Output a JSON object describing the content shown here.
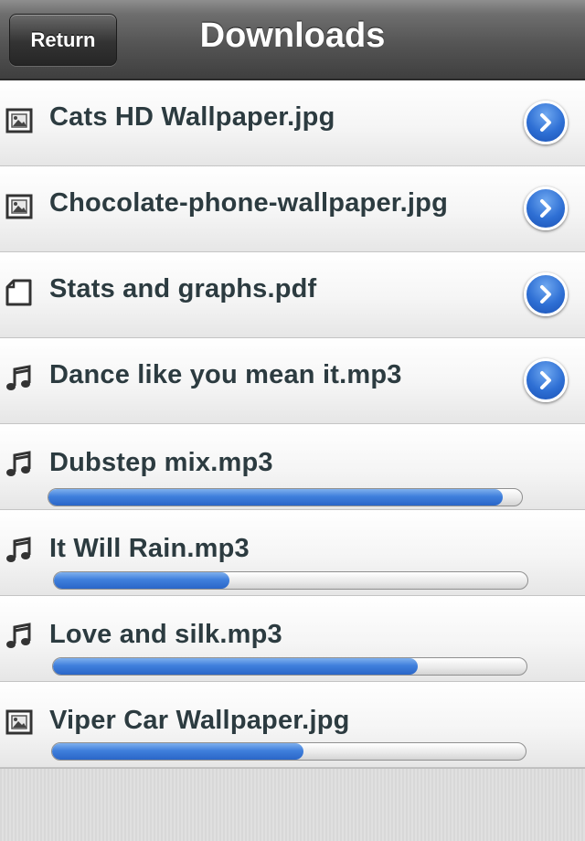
{
  "navbar": {
    "title": "Downloads",
    "return_label": "Return"
  },
  "items": [
    {
      "name": "Cats HD Wallpaper.jpg",
      "type": "image",
      "status": "complete"
    },
    {
      "name": "Chocolate-phone-wallpaper.jpg",
      "type": "image",
      "status": "complete"
    },
    {
      "name": "Stats and graphs.pdf",
      "type": "document",
      "status": "complete"
    },
    {
      "name": "Dance like you mean it.mp3",
      "type": "music",
      "status": "complete"
    },
    {
      "name": "Dubstep mix.mp3",
      "type": "music",
      "status": "downloading",
      "progress": 0.96
    },
    {
      "name": "It Will Rain.mp3",
      "type": "music",
      "status": "downloading",
      "progress": 0.37
    },
    {
      "name": "Love and silk.mp3",
      "type": "music",
      "status": "downloading",
      "progress": 0.77
    },
    {
      "name": "Viper Car Wallpaper.jpg",
      "type": "image",
      "status": "downloading",
      "progress": 0.53
    }
  ],
  "icons": {
    "image": "image-file-icon",
    "document": "document-file-icon",
    "music": "music-note-icon",
    "disclosure": "disclosure-chevron-icon"
  },
  "colors": {
    "accent_blue": "#2e6fd4",
    "label_text": "#2c3b40",
    "navbar": "#555555"
  }
}
